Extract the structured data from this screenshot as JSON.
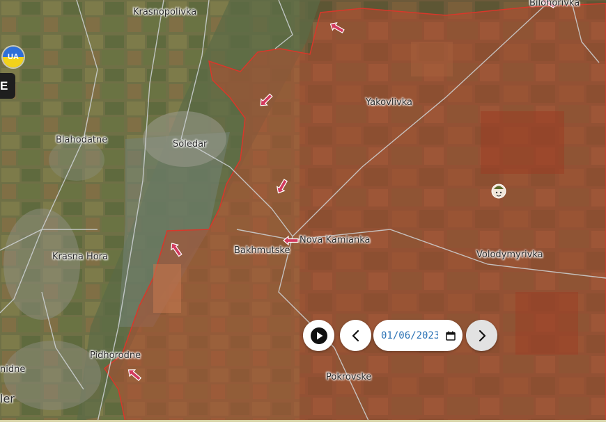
{
  "badge": {
    "label": "UA"
  },
  "side_panel": {
    "label": "E"
  },
  "places": {
    "krasnopolivka": "Krasnopolivka",
    "bilohorivka": "Bilohorivka",
    "yakovlivka": "Yakovlivka",
    "blahodatne": "Blahodatne",
    "soledar": "Soledar",
    "nova_kamianka": "Nova Kamianka",
    "bakhmutske": "Bakhmutske",
    "volodymyrivka": "Volodymyrivka",
    "krasna_hora": "Krasna Hora",
    "pidhorodne": "Pidhorodne",
    "pokrovske": "Pokrovske",
    "edge_left_1": "nidne",
    "edge_left_2": "ler"
  },
  "timeline": {
    "date": "01/06/2023",
    "play_icon": "play-icon",
    "prev_icon": "chevron-left-icon",
    "next_icon": "chevron-right-icon",
    "calendar_icon": "calendar-icon"
  },
  "colors": {
    "occupied_fill": "#b24a2f",
    "occupied_border": "#d9372a",
    "arrow": "#d23a5e"
  },
  "icons": [
    "arrow-icon",
    "soldier-marker-icon"
  ]
}
